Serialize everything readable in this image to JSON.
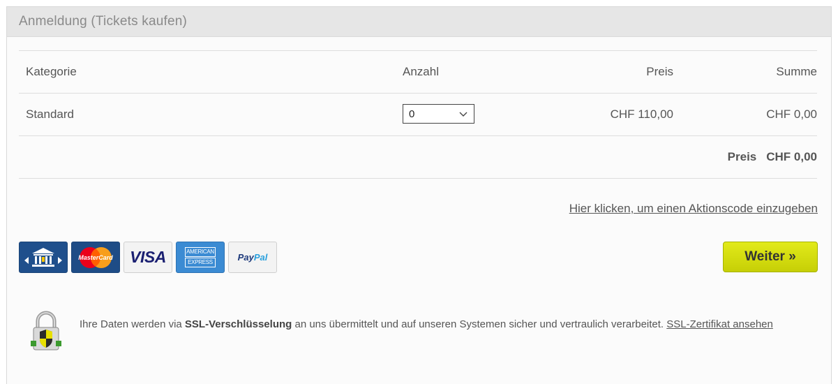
{
  "panel": {
    "title": "Anmeldung (Tickets kaufen)"
  },
  "table": {
    "headers": {
      "kategorie": "Kategorie",
      "anzahl": "Anzahl",
      "preis": "Preis",
      "summe": "Summe"
    },
    "rows": [
      {
        "kategorie": "Standard",
        "anzahl": "0",
        "preis": "CHF 110,00",
        "summe": "CHF 0,00"
      }
    ],
    "total": {
      "label": "Preis",
      "value": "CHF 0,00"
    }
  },
  "promo_link": "Hier klicken, um einen Aktionscode einzugeben",
  "payments": {
    "mastercard_label": "MasterCard",
    "visa_label": "VISA",
    "amex_line1": "AMERICAN",
    "amex_line2": "EXPRESS",
    "paypal_part1": "Pay",
    "paypal_part2": "Pal"
  },
  "weiter_button": "Weiter »",
  "ssl": {
    "text_before": "Ihre Daten werden via ",
    "text_bold": "SSL-Verschlüsselung",
    "text_after": " an uns übermittelt und auf unseren Systemen sicher und vertraulich verarbeitet. ",
    "link": "SSL-Zertifikat ansehen"
  },
  "colors": {
    "accent_button": "#d4dc0f",
    "header_bg": "#e6e6e6"
  }
}
